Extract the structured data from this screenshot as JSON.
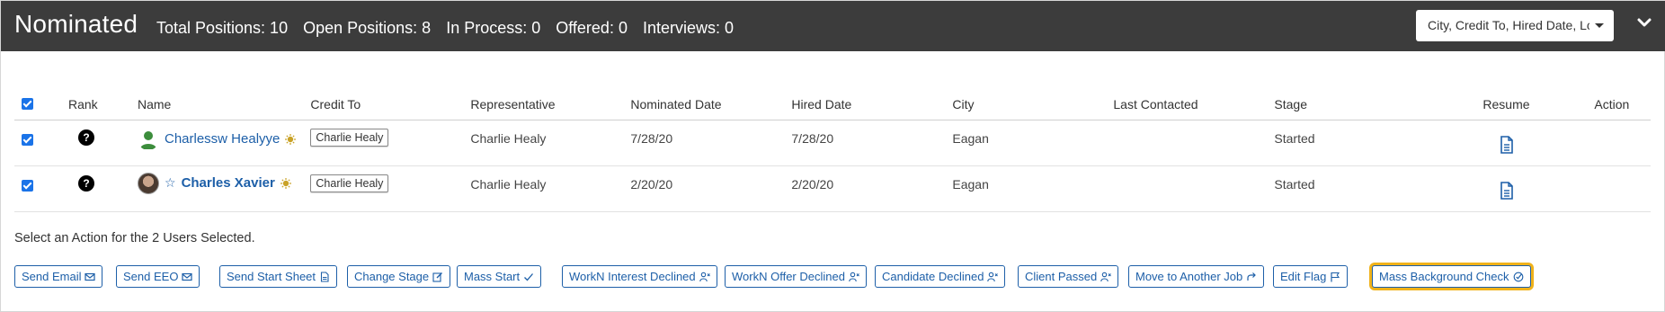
{
  "header": {
    "title": "Nominated",
    "stats": [
      "Total Positions: 10",
      "Open Positions: 8",
      "In Process: 0",
      "Offered: 0",
      "Interviews: 0"
    ],
    "column_select": "City, Credit To, Hired Date, Lc"
  },
  "table": {
    "columns": [
      "Rank",
      "Name",
      "Credit To",
      "Representative",
      "Nominated Date",
      "Hired Date",
      "City",
      "Last Contacted",
      "Stage",
      "Resume",
      "Action"
    ],
    "rows": [
      {
        "name": "Charlessw Healyye",
        "credit_to": "Charlie Healy",
        "representative": "Charlie Healy",
        "nominated_date": "7/28/20",
        "hired_date": "7/28/20",
        "city": "Eagan",
        "last_contacted": "",
        "stage": "Started"
      },
      {
        "name": "Charles Xavier",
        "credit_to": "Charlie Healy",
        "representative": "Charlie Healy",
        "nominated_date": "2/20/20",
        "hired_date": "2/20/20",
        "city": "Eagan",
        "last_contacted": "",
        "stage": "Started"
      }
    ]
  },
  "selection_note": "Select an Action for the 2 Users Selected.",
  "actions": [
    {
      "label": "Send Email",
      "icon": "envelope-icon"
    },
    {
      "label": "Send EEO",
      "icon": "envelope-icon"
    },
    {
      "label": "Send Start Sheet",
      "icon": "document-icon"
    },
    {
      "label": "Change Stage",
      "icon": "edit-icon"
    },
    {
      "label": "Mass Start",
      "icon": "check-icon"
    },
    {
      "label": "WorkN Interest Declined",
      "icon": "user-x-icon"
    },
    {
      "label": "WorkN Offer Declined",
      "icon": "user-x-icon"
    },
    {
      "label": "Candidate Declined",
      "icon": "user-x-icon"
    },
    {
      "label": "Client Passed",
      "icon": "user-x-icon"
    },
    {
      "label": "Move to Another Job",
      "icon": "redo-arrow-icon"
    },
    {
      "label": "Edit Flag",
      "icon": "flag-icon"
    },
    {
      "label": "Mass Background Check",
      "icon": "check-circle-icon"
    }
  ],
  "colors": {
    "header_bg": "#3c3c3c",
    "link": "#1d5fa8",
    "checkbox": "#1a73e8",
    "highlight": "#f0b21a"
  }
}
